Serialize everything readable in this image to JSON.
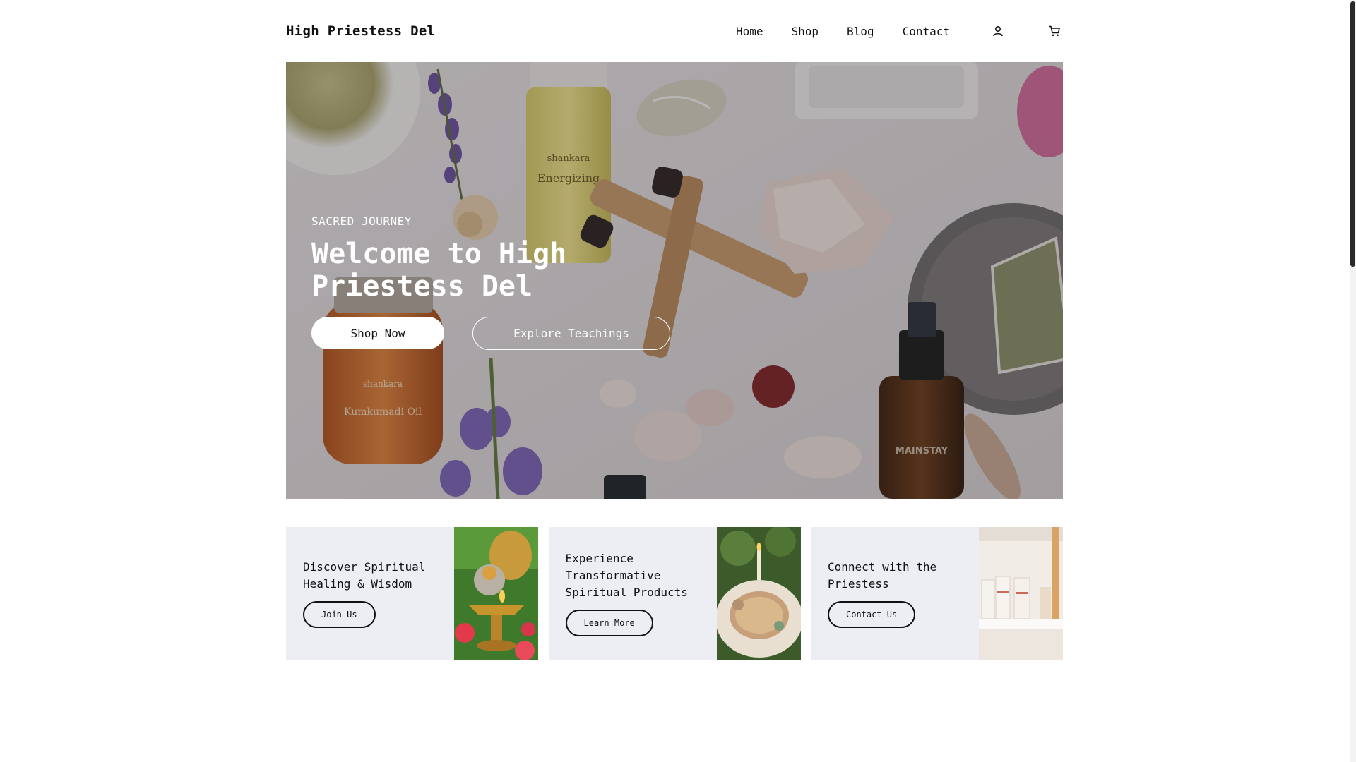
{
  "header": {
    "logo": "High Priestess Del",
    "nav": [
      {
        "label": "Home"
      },
      {
        "label": "Shop"
      },
      {
        "label": "Blog"
      },
      {
        "label": "Contact"
      }
    ],
    "icons": [
      "user-icon",
      "cart-icon"
    ]
  },
  "hero": {
    "eyebrow": "SACRED JOURNEY",
    "title": "Welcome to High Priestess Del",
    "primary_button": "Shop Now",
    "secondary_button": "Explore Teachings",
    "image_product_labels": {
      "bottle1_brand": "shankara",
      "bottle1_name": "Energizing",
      "bottle2_brand": "shankara",
      "bottle2_name": "Kumkumadi Oil",
      "spray_label": "MAINSTAY"
    }
  },
  "cards": [
    {
      "title": "Discover Spiritual Healing & Wisdom",
      "button": "Join Us"
    },
    {
      "title": "Experience Transformative Spiritual Products",
      "button": "Learn More"
    },
    {
      "title": "Connect with the Priestess",
      "button": "Contact Us"
    }
  ],
  "colors": {
    "card_background": "#eceef3",
    "text": "#111111",
    "hero_button_bg": "#ffffff"
  }
}
